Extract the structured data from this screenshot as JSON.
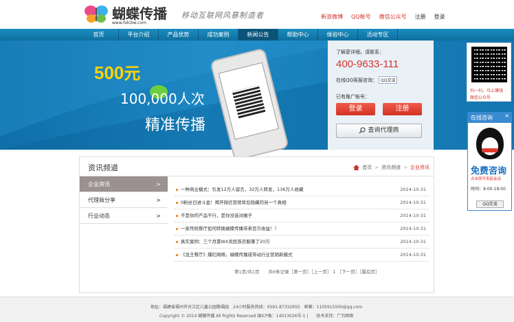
{
  "header": {
    "logo_title": "蝴蝶传播",
    "logo_url": "www.hdcbw.com",
    "slogan": "移动互联网风暴制造者",
    "links": [
      "新浪微博",
      "QQ帐号",
      "微信公众号",
      "注册",
      "登录"
    ]
  },
  "nav": {
    "items": [
      "首页",
      "平台介绍",
      "产品优势",
      "成功案例",
      "新闻公告",
      "帮助中心",
      "体验中心",
      "活动专区"
    ],
    "active_index": 4
  },
  "banner": {
    "promo_amount": "500",
    "promo_unit": "元",
    "promo_line1": "100,000人次",
    "promo_line2": "精准传播"
  },
  "info_panel": {
    "hint": "了解更详细，请联系：",
    "phone": "400-9633-111",
    "qq_label": "在线QQ客服咨询：",
    "qq_button": "QQ交谈",
    "member_label": "已有推广帐号：",
    "login_button": "登录",
    "register_button": "注册",
    "agent_button": "查询代理商"
  },
  "qr_widget": {
    "text1": "扫一扫，马上赚钱",
    "text2": "微信公众号"
  },
  "online_widget": {
    "title": "在线咨询",
    "close": "×",
    "free_title": "免费咨询",
    "free_sub": "点击即可发起会话",
    "time": "时间：9:00-18:00",
    "qq_button": "QQ交谈"
  },
  "content": {
    "title": "资讯频道",
    "breadcrumb": [
      "首页",
      "资讯频道",
      "企业资讯"
    ],
    "breadcrumb_sep": ">",
    "side_items": [
      "企业资讯",
      "代理商分享",
      "行业动态"
    ],
    "side_active_index": 0,
    "articles": [
      {
        "title": "一种商业模式：引发12万人留言，32万人转发，136万人收藏",
        "date": "2014-10-31"
      },
      {
        "title": "0粉丝日进斗金！揭开微信营销背后隐藏的另一个真相",
        "date": "2014-10-31"
      },
      {
        "title": "不是你的产品不行，是你没选对圈子",
        "date": "2014-10-31"
      },
      {
        "title": "一家传统餐厅如何转换蝴蝶传播带来百万收益！！",
        "date": "2014-10-31"
      },
      {
        "title": "真实案例：三个月靠WX卖民族衣服赚了20万",
        "date": "2014-10-31"
      },
      {
        "title": "《龙王餐厅》爆红网络，蝴蝶传播成带动行业营销新模式",
        "date": "2014-10-31"
      }
    ],
    "pager": "第1页/共1页　　共6条记录［第一页］［上一页］ 1 ［下一页］［最后页］"
  },
  "footer": {
    "line1": "地址：福建省福州市台江区儿童公园路福园　24小时服务热线：0591-87332955　邮箱：1105915500@qq.com",
    "line2": "Copyright © 2014 蝴蝶传播 All Rights Reserved 闽ICP备：14013026号-1 |　　技术支持：广为网络"
  },
  "colors": {
    "accent_red": "#d4322c",
    "nav_blue": "#1b8dc0",
    "banner_blue": "#1d87c3",
    "promo_yellow": "#ffd400"
  }
}
